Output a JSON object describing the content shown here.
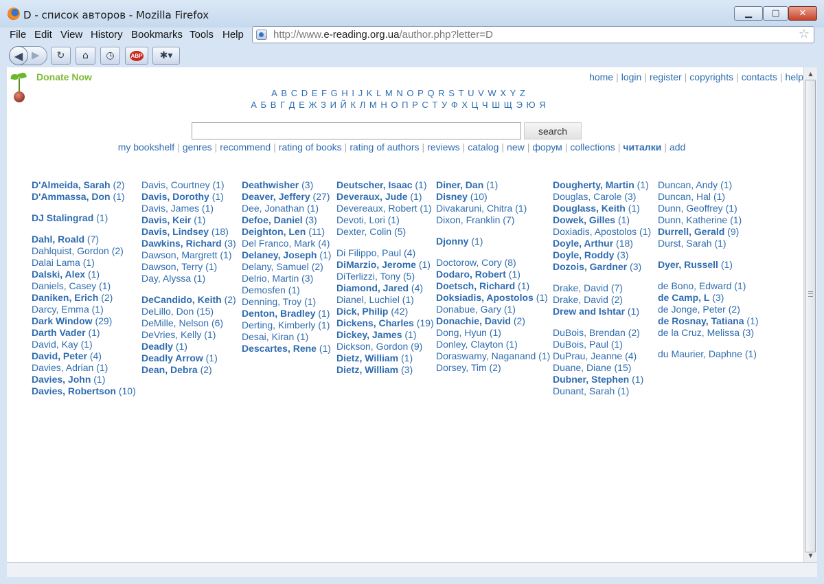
{
  "window": {
    "title": "D - список авторов - Mozilla Firefox",
    "buttons": {
      "minimize": "▁",
      "maximize": "▢",
      "close": "✕"
    }
  },
  "menu": [
    "File",
    "Edit",
    "View",
    "History",
    "Bookmarks",
    "Tools",
    "Help"
  ],
  "address": {
    "prefix": "http://www.",
    "domain": "e-reading.org.ua",
    "path": "/author.php?letter=D"
  },
  "toolbar": {
    "abp_label": "ABP"
  },
  "site": {
    "donate": "Donate Now",
    "toplinks": [
      "home",
      "login",
      "register",
      "copyrights",
      "contacts",
      "help"
    ],
    "latin": [
      "A",
      "B",
      "C",
      "D",
      "E",
      "F",
      "G",
      "H",
      "I",
      "J",
      "K",
      "L",
      "M",
      "N",
      "O",
      "P",
      "Q",
      "R",
      "S",
      "T",
      "U",
      "V",
      "W",
      "X",
      "Y",
      "Z"
    ],
    "cyrillic": [
      "А",
      "Б",
      "В",
      "Г",
      "Д",
      "Е",
      "Ж",
      "З",
      "И",
      "Й",
      "К",
      "Л",
      "М",
      "Н",
      "О",
      "П",
      "Р",
      "С",
      "Т",
      "У",
      "Ф",
      "Х",
      "Ц",
      "Ч",
      "Ш",
      "Щ",
      "Э",
      "Ю",
      "Я"
    ],
    "search_value": "",
    "search_button": "search",
    "nav": [
      {
        "label": "my bookshelf",
        "bold": false
      },
      {
        "label": "genres",
        "bold": false
      },
      {
        "label": "recommend",
        "bold": false
      },
      {
        "label": "rating of books",
        "bold": false
      },
      {
        "label": "rating of authors",
        "bold": false
      },
      {
        "label": "reviews",
        "bold": false
      },
      {
        "label": "catalog",
        "bold": false
      },
      {
        "label": "new",
        "bold": false
      },
      {
        "label": "форум",
        "bold": false
      },
      {
        "label": "collections",
        "bold": false
      },
      {
        "label": "читалки",
        "bold": true
      },
      {
        "label": "add",
        "bold": false
      }
    ]
  },
  "authors": [
    [
      {
        "name": "D'Almeida, Sarah",
        "count": "(2)",
        "bold": true
      },
      {
        "name": "D'Ammassa, Don",
        "count": "(1)",
        "bold": true
      },
      {
        "name": "DJ Stalingrad",
        "count": "(1)",
        "bold": true,
        "gap": true
      },
      {
        "name": "Dahl, Roald",
        "count": "(7)",
        "bold": true,
        "gap": true
      },
      {
        "name": "Dahlquist, Gordon",
        "count": "(2)",
        "bold": false
      },
      {
        "name": "Dalai Lama",
        "count": "(1)",
        "bold": false
      },
      {
        "name": "Dalski, Alex",
        "count": "(1)",
        "bold": true
      },
      {
        "name": "Daniels, Casey",
        "count": "(1)",
        "bold": false
      },
      {
        "name": "Daniken, Erich",
        "count": "(2)",
        "bold": true
      },
      {
        "name": "Darcy, Emma",
        "count": "(1)",
        "bold": false
      },
      {
        "name": "Dark Window",
        "count": "(29)",
        "bold": true
      },
      {
        "name": "Darth Vader",
        "count": "(1)",
        "bold": true
      },
      {
        "name": "David, Kay",
        "count": "(1)",
        "bold": false
      },
      {
        "name": "David, Peter",
        "count": "(4)",
        "bold": true
      },
      {
        "name": "Davies, Adrian",
        "count": "(1)",
        "bold": false
      },
      {
        "name": "Davies, John",
        "count": "(1)",
        "bold": true
      },
      {
        "name": "Davies, Robertson",
        "count": "(10)",
        "bold": true
      }
    ],
    [
      {
        "name": "Davis, Courtney",
        "count": "(1)",
        "bold": false
      },
      {
        "name": "Davis, Dorothy",
        "count": "(1)",
        "bold": true
      },
      {
        "name": "Davis, James",
        "count": "(1)",
        "bold": false
      },
      {
        "name": "Davis, Keir",
        "count": "(1)",
        "bold": true
      },
      {
        "name": "Davis, Lindsey",
        "count": "(18)",
        "bold": true
      },
      {
        "name": "Dawkins, Richard",
        "count": "(3)",
        "bold": true
      },
      {
        "name": "Dawson, Margrett",
        "count": "(1)",
        "bold": false
      },
      {
        "name": "Dawson, Terry",
        "count": "(1)",
        "bold": false
      },
      {
        "name": "Day, Alyssa",
        "count": "(1)",
        "bold": false
      },
      {
        "name": "DeCandido, Keith",
        "count": "(2)",
        "bold": true,
        "gap": true
      },
      {
        "name": "DeLillo, Don",
        "count": "(15)",
        "bold": false
      },
      {
        "name": "DeMille, Nelson",
        "count": "(6)",
        "bold": false
      },
      {
        "name": "DeVries, Kelly",
        "count": "(1)",
        "bold": false
      },
      {
        "name": "Deadly",
        "count": "(1)",
        "bold": true
      },
      {
        "name": "Deadly Arrow",
        "count": "(1)",
        "bold": true
      },
      {
        "name": "Dean, Debra",
        "count": "(2)",
        "bold": true
      }
    ],
    [
      {
        "name": "Deathwisher",
        "count": "(3)",
        "bold": true
      },
      {
        "name": "Deaver, Jeffery",
        "count": "(27)",
        "bold": true
      },
      {
        "name": "Dee, Jonathan",
        "count": "(1)",
        "bold": false
      },
      {
        "name": "Defoe, Daniel",
        "count": "(3)",
        "bold": true
      },
      {
        "name": "Deighton, Len",
        "count": "(11)",
        "bold": true
      },
      {
        "name": "Del Franco, Mark",
        "count": "(4)",
        "bold": false
      },
      {
        "name": "Delaney, Joseph",
        "count": "(1)",
        "bold": true
      },
      {
        "name": "Delany, Samuel",
        "count": "(2)",
        "bold": false
      },
      {
        "name": "Delrio, Martin",
        "count": "(3)",
        "bold": false
      },
      {
        "name": "Demosfen",
        "count": "(1)",
        "bold": false
      },
      {
        "name": "Denning, Troy",
        "count": "(1)",
        "bold": false
      },
      {
        "name": "Denton, Bradley",
        "count": "(1)",
        "bold": true
      },
      {
        "name": "Derting, Kimberly",
        "count": "(1)",
        "bold": false
      },
      {
        "name": "Desai, Kiran",
        "count": "(1)",
        "bold": false
      },
      {
        "name": "Descartes, Rene",
        "count": "(1)",
        "bold": true
      }
    ],
    [
      {
        "name": "Deutscher, Isaac",
        "count": "(1)",
        "bold": true
      },
      {
        "name": "Deveraux, Jude",
        "count": "(1)",
        "bold": true
      },
      {
        "name": "Devereaux, Robert",
        "count": "(1)",
        "bold": false
      },
      {
        "name": "Devoti, Lori",
        "count": "(1)",
        "bold": false
      },
      {
        "name": "Dexter, Colin",
        "count": "(5)",
        "bold": false
      },
      {
        "name": "Di Filippo, Paul",
        "count": "(4)",
        "bold": false,
        "gap": true
      },
      {
        "name": "DiMarzio, Jerome",
        "count": "(1)",
        "bold": true
      },
      {
        "name": "DiTerlizzi, Tony",
        "count": "(5)",
        "bold": false
      },
      {
        "name": "Diamond, Jared",
        "count": "(4)",
        "bold": true
      },
      {
        "name": "Dianel, Luchiel",
        "count": "(1)",
        "bold": false
      },
      {
        "name": "Dick, Philip",
        "count": "(42)",
        "bold": true
      },
      {
        "name": "Dickens, Charles",
        "count": "(19)",
        "bold": true
      },
      {
        "name": "Dickey, James",
        "count": "(1)",
        "bold": true
      },
      {
        "name": "Dickson, Gordon",
        "count": "(9)",
        "bold": false
      },
      {
        "name": "Dietz, William",
        "count": "(1)",
        "bold": true
      },
      {
        "name": "Dietz, William",
        "count": "(3)",
        "bold": true
      }
    ],
    [
      {
        "name": "Diner, Dan",
        "count": "(1)",
        "bold": true
      },
      {
        "name": "Disney",
        "count": "(10)",
        "bold": true
      },
      {
        "name": "Divakaruni, Chitra",
        "count": "(1)",
        "bold": false
      },
      {
        "name": "Dixon, Franklin",
        "count": "(7)",
        "bold": false
      },
      {
        "name": "Djonny",
        "count": "(1)",
        "bold": true,
        "gap": true
      },
      {
        "name": "Doctorow, Cory",
        "count": "(8)",
        "bold": false,
        "gap": true
      },
      {
        "name": "Dodaro, Robert",
        "count": "(1)",
        "bold": true
      },
      {
        "name": "Doetsch, Richard",
        "count": "(1)",
        "bold": true
      },
      {
        "name": "Doksiadis, Apostolos",
        "count": "(1)",
        "bold": true
      },
      {
        "name": "Donabue, Gary",
        "count": "(1)",
        "bold": false
      },
      {
        "name": "Donachie, David",
        "count": "(2)",
        "bold": true
      },
      {
        "name": "Dong, Hyun",
        "count": "(1)",
        "bold": false
      },
      {
        "name": "Donley, Clayton",
        "count": "(1)",
        "bold": false
      },
      {
        "name": "Doraswamy, Naganand",
        "count": "(1)",
        "bold": false
      },
      {
        "name": "Dorsey, Tim",
        "count": "(2)",
        "bold": false
      }
    ],
    [
      {
        "name": "Dougherty, Martin",
        "count": "(1)",
        "bold": true
      },
      {
        "name": "Douglas, Carole",
        "count": "(3)",
        "bold": false
      },
      {
        "name": "Douglass, Keith",
        "count": "(1)",
        "bold": true
      },
      {
        "name": "Dowek, Gilles",
        "count": "(1)",
        "bold": true
      },
      {
        "name": "Doxiadis, Apostolos",
        "count": "(1)",
        "bold": false
      },
      {
        "name": "Doyle, Arthur",
        "count": "(18)",
        "bold": true
      },
      {
        "name": "Doyle, Roddy",
        "count": "(3)",
        "bold": true
      },
      {
        "name": "Dozois, Gardner",
        "count": "(3)",
        "bold": true
      },
      {
        "name": "Drake, David",
        "count": "(7)",
        "bold": false,
        "gap": true
      },
      {
        "name": "Drake, David",
        "count": "(2)",
        "bold": false
      },
      {
        "name": "Drew and Ishtar",
        "count": "(1)",
        "bold": true
      },
      {
        "name": "DuBois, Brendan",
        "count": "(2)",
        "bold": false,
        "gap": true
      },
      {
        "name": "DuBois, Paul",
        "count": "(1)",
        "bold": false
      },
      {
        "name": "DuPrau, Jeanne",
        "count": "(4)",
        "bold": false
      },
      {
        "name": "Duane, Diane",
        "count": "(15)",
        "bold": false
      },
      {
        "name": "Dubner, Stephen",
        "count": "(1)",
        "bold": true
      },
      {
        "name": "Dunant, Sarah",
        "count": "(1)",
        "bold": false
      }
    ],
    [
      {
        "name": "Duncan, Andy",
        "count": "(1)",
        "bold": false
      },
      {
        "name": "Duncan, Hal",
        "count": "(1)",
        "bold": false
      },
      {
        "name": "Dunn, Geoffrey",
        "count": "(1)",
        "bold": false
      },
      {
        "name": "Dunn, Katherine",
        "count": "(1)",
        "bold": false
      },
      {
        "name": "Durrell, Gerald",
        "count": "(9)",
        "bold": true
      },
      {
        "name": "Durst, Sarah",
        "count": "(1)",
        "bold": false
      },
      {
        "name": "Dyer, Russell",
        "count": "(1)",
        "bold": true,
        "gap": true
      },
      {
        "name": "de Bono, Edward",
        "count": "(1)",
        "bold": false,
        "gap": true
      },
      {
        "name": "de Camp, L",
        "count": "(3)",
        "bold": true
      },
      {
        "name": "de Jonge, Peter",
        "count": "(2)",
        "bold": false
      },
      {
        "name": "de Rosnay, Tatiana",
        "count": "(1)",
        "bold": true
      },
      {
        "name": "de la Cruz, Melissa",
        "count": "(3)",
        "bold": false
      },
      {
        "name": "du Maurier, Daphne",
        "count": "(1)",
        "bold": false,
        "gap": true
      }
    ]
  ]
}
